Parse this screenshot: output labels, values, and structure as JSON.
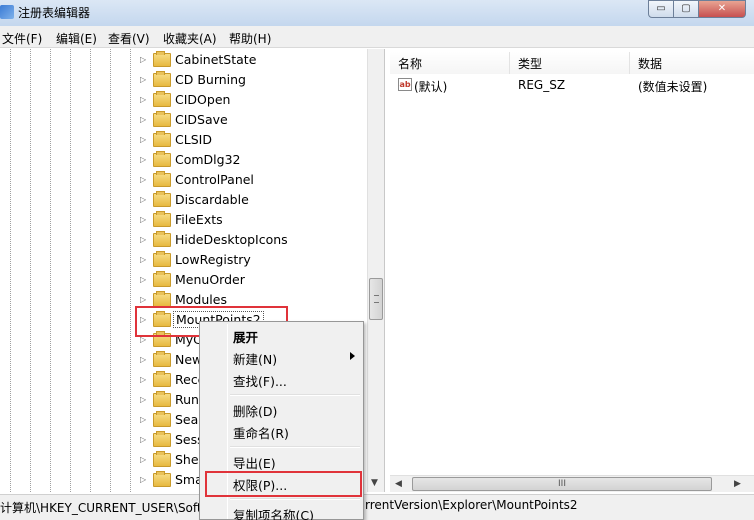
{
  "window": {
    "title": "注册表编辑器",
    "minimize": "▭",
    "maximize": "▢",
    "close": "✕"
  },
  "menu": [
    "文件(F)",
    "编辑(E)",
    "查看(V)",
    "收藏夹(A)",
    "帮助(H)"
  ],
  "tree": {
    "items": [
      "CabinetState",
      "CD Burning",
      "CIDOpen",
      "CIDSave",
      "CLSID",
      "ComDlg32",
      "ControlPanel",
      "Discardable",
      "FileExts",
      "HideDesktopIcons",
      "LowRegistry",
      "MenuOrder",
      "Modules",
      "MountPoints2",
      "MyC",
      "New",
      "Rece",
      "Run",
      "Sear",
      "Sess",
      "Shel",
      "Sma"
    ],
    "selected": "MountPoints2"
  },
  "list": {
    "headers": {
      "name": "名称",
      "type": "类型",
      "data": "数据"
    },
    "rows": [
      {
        "icon": "ab",
        "name": "(默认)",
        "type": "REG_SZ",
        "data": "(数值未设置)"
      }
    ]
  },
  "context_menu": {
    "items": [
      {
        "label": "展开",
        "bold": true
      },
      {
        "label": "新建(N)",
        "submenu": true
      },
      {
        "label": "查找(F)..."
      },
      {
        "label": "删除(D)"
      },
      {
        "label": "重命名(R)"
      },
      {
        "label": "导出(E)"
      },
      {
        "label": "权限(P)..."
      },
      {
        "label": "复制项名称(C)"
      }
    ]
  },
  "status": {
    "left": "计算机\\HKEY_CURRENT_USER\\Softw",
    "right": "rrentVersion\\Explorer\\MountPoints2"
  },
  "scroll": {
    "hthumb_grip": "III"
  },
  "highlight_color": "#e0333a"
}
